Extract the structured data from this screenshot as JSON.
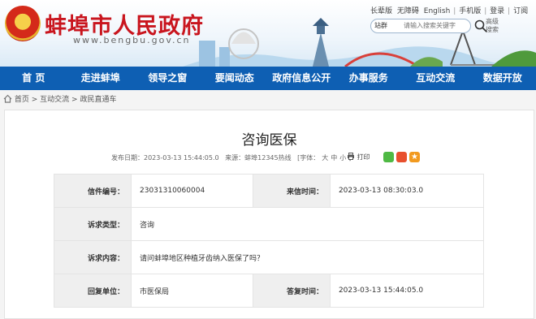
{
  "header": {
    "site_title": "蚌埠市人民政府",
    "domain": "www.bengbu.gov.cn",
    "toplinks": [
      "长辈版",
      "无障碍",
      "English",
      "手机版",
      "登录",
      "订阅"
    ],
    "search": {
      "scope": "站群",
      "placeholder": "请输入搜索关键字",
      "advanced": "高级搜索"
    }
  },
  "nav": [
    "首 页",
    "走进蚌埠",
    "领导之窗",
    "要闻动态",
    "政府信息公开",
    "办事服务",
    "互动交流",
    "数据开放"
  ],
  "breadcrumb": [
    "首页",
    "互动交流",
    "政民直通车"
  ],
  "article": {
    "title": "咨询医保",
    "published": "发布日期：2023-03-13 15:44:05.0",
    "source": "来源：蚌埠12345热线",
    "font_label": "[字体：",
    "font_sizes": [
      "大",
      "中",
      "小"
    ],
    "font_close": "]",
    "print": "打印"
  },
  "table": {
    "row1": {
      "l1": "信件编号：",
      "v1": "23031310060004",
      "l2": "来信时间：",
      "v2": "2023-03-13 08:30:03.0"
    },
    "row2": {
      "l1": "诉求类型：",
      "v1": "咨询"
    },
    "row3": {
      "l1": "诉求内容：",
      "v1": "请问蚌埠地区种植牙齿纳入医保了吗？"
    },
    "row4": {
      "l1": "回复单位：",
      "v1": "市医保局",
      "l2": "答复时间：",
      "v2": "2023-03-13 15:44:05.0"
    }
  },
  "colors": {
    "nav_bg": "#0e5fb3",
    "title_red": "#c9151e",
    "wechat": "#4fb944",
    "weibo": "#e8502e",
    "favorite": "#f29a1f"
  }
}
